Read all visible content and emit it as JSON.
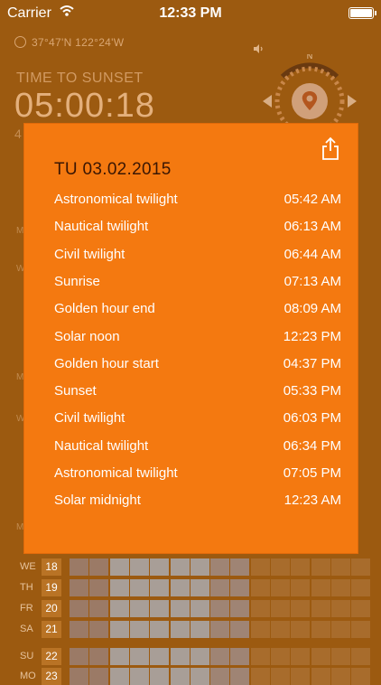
{
  "status_bar": {
    "carrier": "Carrier",
    "time": "12:33 PM"
  },
  "background": {
    "coordinates": "37°47'N 122°24'W",
    "label": "TIME TO SUNSET",
    "countdown": "05:00:18",
    "partial_digit": "4",
    "compass_letter": "N",
    "days": [
      {
        "name": "WE",
        "num": "18"
      },
      {
        "name": "TH",
        "num": "19"
      },
      {
        "name": "FR",
        "num": "20"
      },
      {
        "name": "SA",
        "num": "21"
      },
      {
        "name": "SU",
        "num": "22"
      },
      {
        "name": "MO",
        "num": "23"
      }
    ]
  },
  "panel": {
    "date": "TU 03.02.2015",
    "events": [
      {
        "name": "Astronomical twilight",
        "time": "05:42 AM"
      },
      {
        "name": "Nautical twilight",
        "time": "06:13 AM"
      },
      {
        "name": "Civil twilight",
        "time": "06:44 AM"
      },
      {
        "name": "Sunrise",
        "time": "07:13 AM"
      },
      {
        "name": "Golden hour end",
        "time": "08:09 AM"
      },
      {
        "name": "Solar noon",
        "time": "12:23 PM"
      },
      {
        "name": "Golden hour start",
        "time": "04:37 PM"
      },
      {
        "name": "Sunset",
        "time": "05:33 PM"
      },
      {
        "name": "Civil twilight",
        "time": "06:03 PM"
      },
      {
        "name": "Nautical twilight",
        "time": "06:34 PM"
      },
      {
        "name": "Astronomical twilight",
        "time": "07:05 PM"
      },
      {
        "name": "Solar midnight",
        "time": "12:23 AM"
      }
    ]
  },
  "colors": {
    "background": "#9c5a10",
    "panel": "#f47910",
    "date_text": "#3a1603"
  }
}
